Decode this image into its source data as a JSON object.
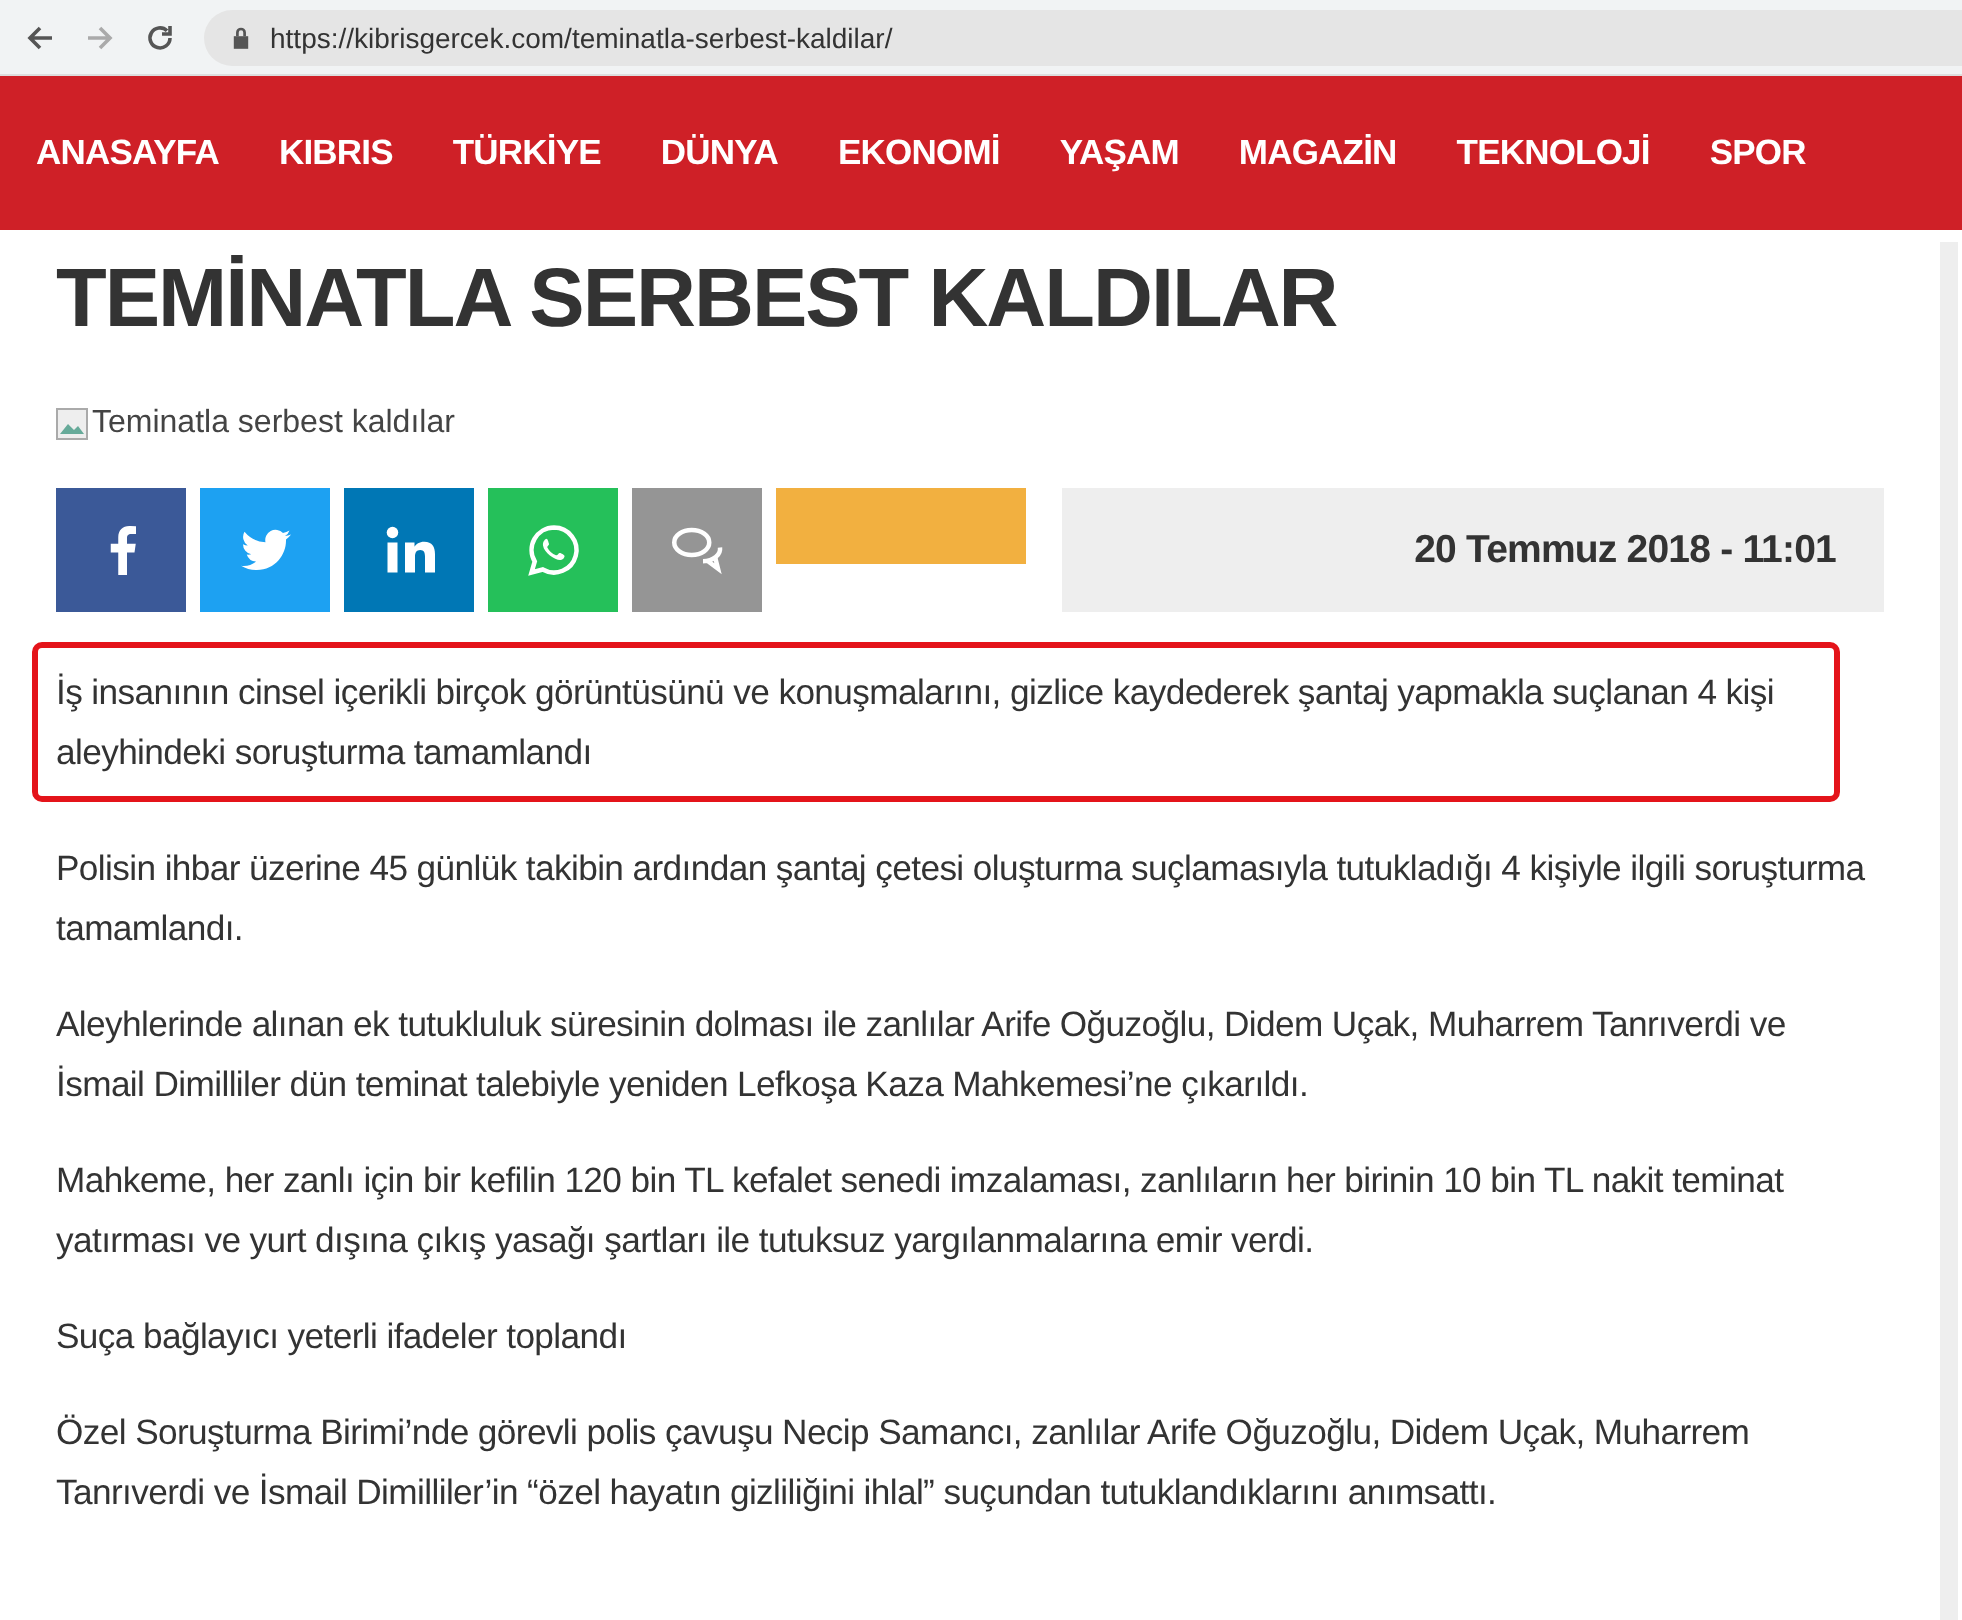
{
  "browser": {
    "url": "https://kibrisgercek.com/teminatla-serbest-kaldilar/"
  },
  "nav": [
    {
      "label": "ANASAYFA"
    },
    {
      "label": "KIBRIS"
    },
    {
      "label": "TÜRKİYE"
    },
    {
      "label": "DÜNYA"
    },
    {
      "label": "EKONOMİ"
    },
    {
      "label": "YAŞAM"
    },
    {
      "label": "MAGAZİN"
    },
    {
      "label": "TEKNOLOJİ"
    },
    {
      "label": "SPOR"
    }
  ],
  "article": {
    "title": "TEMİNATLA SERBEST KALDILAR",
    "image_alt": "Teminatla serbest kaldılar",
    "share": [
      {
        "kind": "facebook"
      },
      {
        "kind": "twitter"
      },
      {
        "kind": "linkedin"
      },
      {
        "kind": "whatsapp"
      },
      {
        "kind": "comment"
      },
      {
        "kind": "blank"
      }
    ],
    "date": "20 Temmuz 2018 - 11:01",
    "summary": "İş insanının cinsel içerikli birçok görüntüsünü ve konuşmalarını, gizlice kaydederek şantaj yapmakla suçlanan 4 kişi aleyhindeki soruşturma tamamlandı",
    "paragraphs": [
      "Polisin ihbar üzerine 45 günlük takibin ardından şantaj çetesi oluşturma suçlamasıyla tutukladığı 4 kişiyle ilgili soruşturma tamamlandı.",
      "Aleyhlerinde alınan ek tutukluluk süresinin dolması ile zanlılar Arife Oğuzoğlu, Didem Uçak, Muharrem Tanrıverdi ve İsmail Dimilliler dün teminat talebiyle yeniden Lefkoşa Kaza Mahkemesi’ne çıkarıldı.",
      "Mahkeme, her zanlı için bir kefilin 120 bin TL kefalet senedi imzalaması, zanlıların her birinin 10 bin TL nakit teminat yatırması ve yurt dışına çıkış yasağı şartları ile tutuksuz yargılanmalarına emir verdi.",
      "Suça bağlayıcı yeterli ifadeler toplandı",
      "Özel Soruşturma Birimi’nde görevli polis çavuşu Necip Samancı, zanlılar Arife Oğuzoğlu, Didem Uçak, Muharrem Tanrıverdi ve İsmail Dimilliler’in “özel hayatın gizliliğini ihlal” suçundan tutuklandıklarını anımsattı."
    ]
  }
}
